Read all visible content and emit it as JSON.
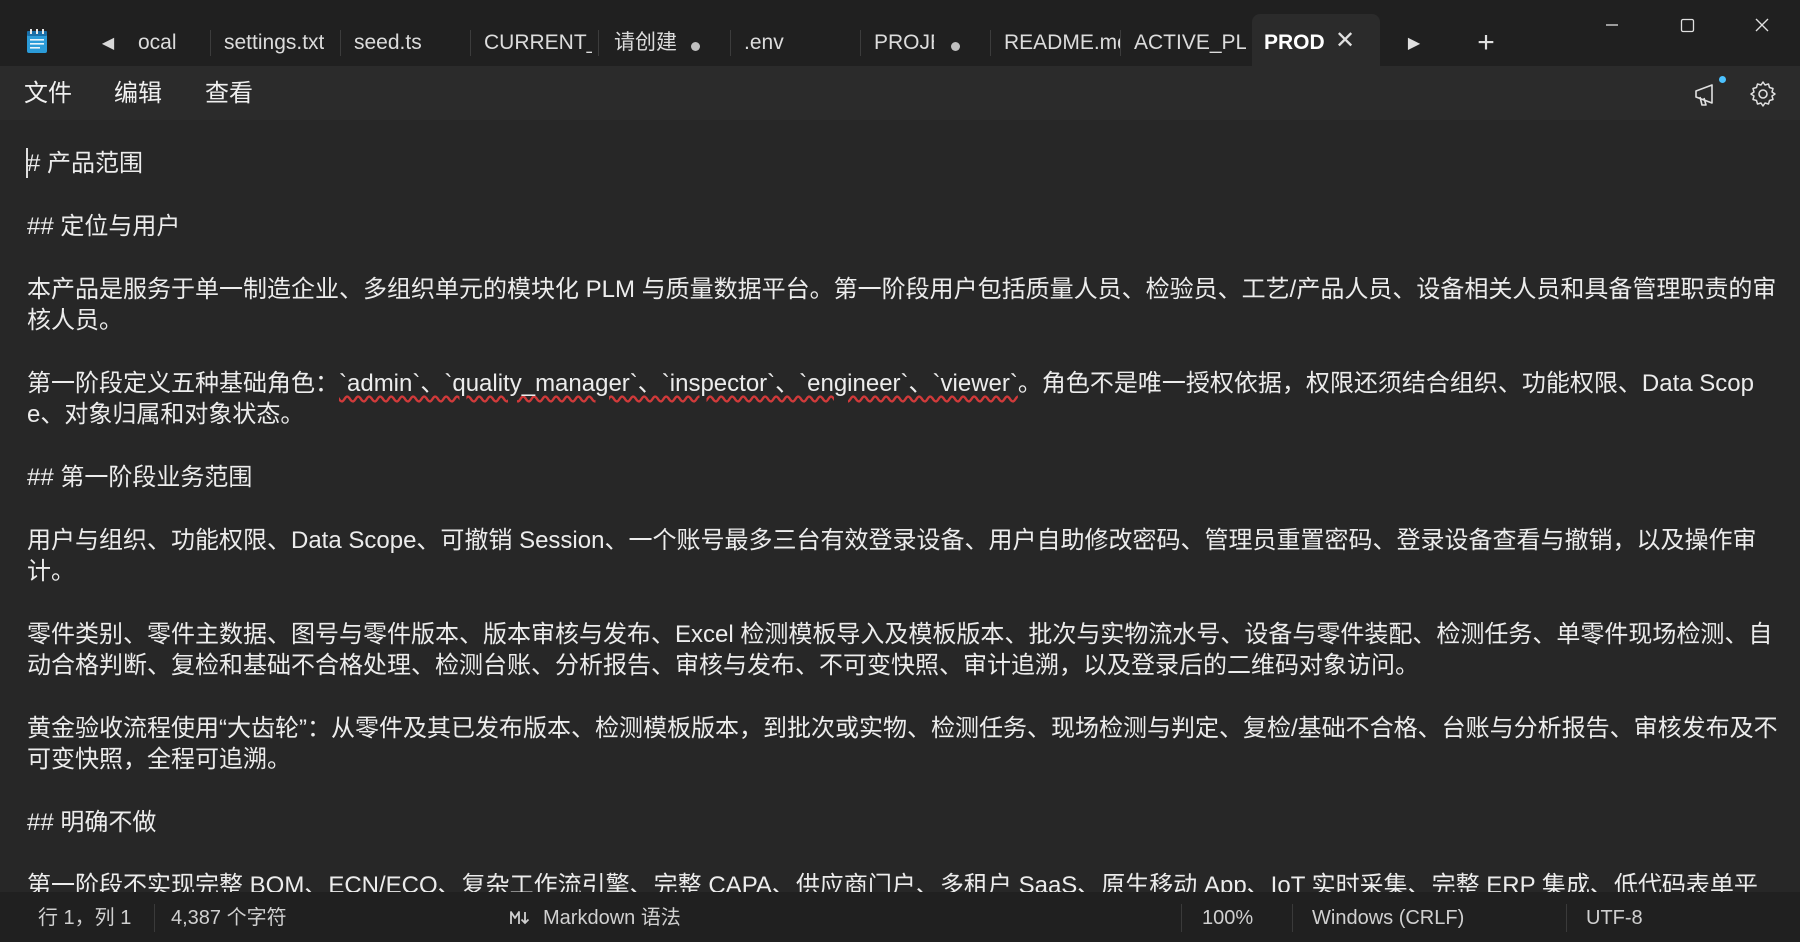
{
  "tabs": [
    {
      "label": "ocal",
      "modified": false
    },
    {
      "label": "settings.txt",
      "modified": false
    },
    {
      "label": "seed.ts",
      "modified": false
    },
    {
      "label": "CURRENT_ST",
      "modified": false
    },
    {
      "label": "请创建",
      "modified": true
    },
    {
      "label": ".env",
      "modified": false
    },
    {
      "label": "PROJE(",
      "modified": true
    },
    {
      "label": "README.md",
      "modified": false
    },
    {
      "label": "ACTIVE_PLAI",
      "modified": false
    },
    {
      "label": "PROD",
      "modified": false,
      "active": true
    }
  ],
  "icons": {
    "app": "notepad-icon",
    "tab_scroll_left": "caret-left-icon",
    "tab_close": "close-icon",
    "tab_scroll_right": "caret-right-icon",
    "new_tab": "plus-icon",
    "minimize": "minimize-icon",
    "maximize": "maximize-icon",
    "close": "close-icon",
    "feedback": "feedback-megaphone-icon",
    "settings": "gear-icon",
    "markdown": "markdown-icon"
  },
  "menu": {
    "file": "文件",
    "edit": "编辑",
    "view": "查看"
  },
  "editor": {
    "lines": {
      "h1": "# 产品范围",
      "h2_positioning": "## 定位与用户",
      "p1": "本产品是服务于单一制造企业、多组织单元的模块化 PLM 与质量数据平台。第一阶段用户包括质量人员、检验员、工艺/产品人员、设备相关人员和具备管理职责的审核人员。",
      "p2_prefix": "第一阶段定义五种基础角色：",
      "p2_roles": "`admin`、`quality_manager`、`inspector`、`engineer`、`viewer`",
      "p2_suffix": "。角色不是唯一授权依据，权限还须结合组织、功能权限、Data Scope、对象归属和对象状态。",
      "h2_scope": "## 第一阶段业务范围",
      "p3": "用户与组织、功能权限、Data Scope、可撤销 Session、一个账号最多三台有效登录设备、用户自助修改密码、管理员重置密码、登录设备查看与撤销，以及操作审计。",
      "p4": "零件类别、零件主数据、图号与零件版本、版本审核与发布、Excel 检测模板导入及模板版本、批次与实物流水号、设备与零件装配、检测任务、单零件现场检测、自动合格判断、复检和基础不合格处理、检测台账、分析报告、审核与发布、不可变快照、审计追溯，以及登录后的二维码对象访问。",
      "p5": "黄金验收流程使用“大齿轮”：从零件及其已发布版本、检测模板版本，到批次或实物、检测任务、现场检测与判定、复检/基础不合格、台账与分析报告、审核发布及不可变快照，全程可追溯。",
      "h2_exclusions": "## 明确不做",
      "p6": "第一阶段不实现完整 BOM、ECN/ECO、复杂工作流引擎、完整 CAPA、供应商门户、多租户 SaaS、原生移动 App、IoT 实时采集、完整 ERP 集成、低代码表单平"
    }
  },
  "status": {
    "position": "行 1，列 1",
    "char_count": "4,387 个字符",
    "language": "Markdown 语法",
    "zoom": "100%",
    "line_ending": "Windows (CRLF)",
    "encoding": "UTF-8"
  }
}
